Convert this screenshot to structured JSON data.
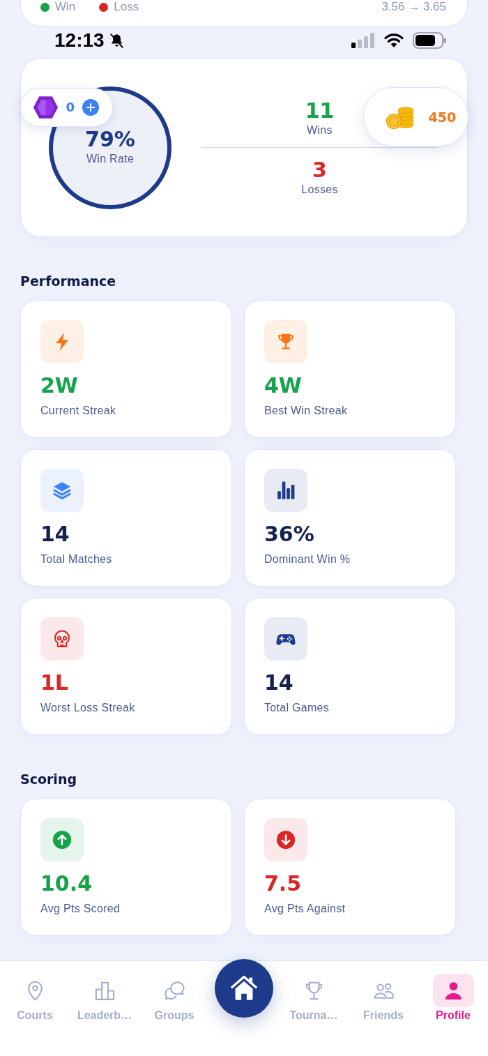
{
  "top_card": {
    "legend": [
      {
        "label": "Win",
        "color": "#16a34a"
      },
      {
        "label": "Loss",
        "color": "#dc2626"
      }
    ],
    "rating_change": "3.56 → 3.65"
  },
  "status_bar": {
    "time": "12:13",
    "silent": true
  },
  "summary": {
    "win_rate": {
      "value": "79%",
      "label": "Win Rate"
    },
    "stats": [
      {
        "value": "11",
        "label": "Wins",
        "color": "#16a34a"
      },
      {
        "value": "3",
        "label": "Losses",
        "color": "#dc2626"
      }
    ],
    "gems": {
      "count": "0"
    },
    "coins": {
      "count": "450"
    }
  },
  "sections": [
    {
      "title": "Performance",
      "cards": [
        {
          "kind": "bolt",
          "value": "2W",
          "color": "#16a34a",
          "label": "Current Streak"
        },
        {
          "kind": "trophy",
          "value": "4W",
          "color": "#16a34a",
          "label": "Best Win Streak"
        },
        {
          "kind": "layers",
          "value": "14",
          "color": "#14224f",
          "label": "Total Matches"
        },
        {
          "kind": "bars",
          "value": "36%",
          "color": "#14224f",
          "label": "Dominant Win %"
        },
        {
          "kind": "skull",
          "value": "1L",
          "color": "#dc2626",
          "label": "Worst Loss Streak"
        },
        {
          "kind": "gamepad",
          "value": "14",
          "color": "#14224f",
          "label": "Total Games"
        }
      ]
    },
    {
      "title": "Scoring",
      "cards": [
        {
          "kind": "arrow_up",
          "value": "10.4",
          "color": "#16a34a",
          "label": "Avg Pts Scored"
        },
        {
          "kind": "arrow_down",
          "value": "7.5",
          "color": "#dc2626",
          "label": "Avg Pts Against"
        }
      ]
    }
  ],
  "nav": {
    "items": [
      {
        "kind": "pin",
        "label": "Courts",
        "selected": false
      },
      {
        "kind": "podium",
        "label": "Leaderb…",
        "selected": false
      },
      {
        "kind": "chat",
        "label": "Groups",
        "selected": false
      },
      {
        "kind": "home",
        "selected": false
      },
      {
        "kind": "trophy",
        "label": "Tourna…",
        "selected": false
      },
      {
        "kind": "people",
        "label": "Friends",
        "selected": false
      },
      {
        "kind": "person",
        "label": "Profile",
        "selected": true
      }
    ]
  }
}
